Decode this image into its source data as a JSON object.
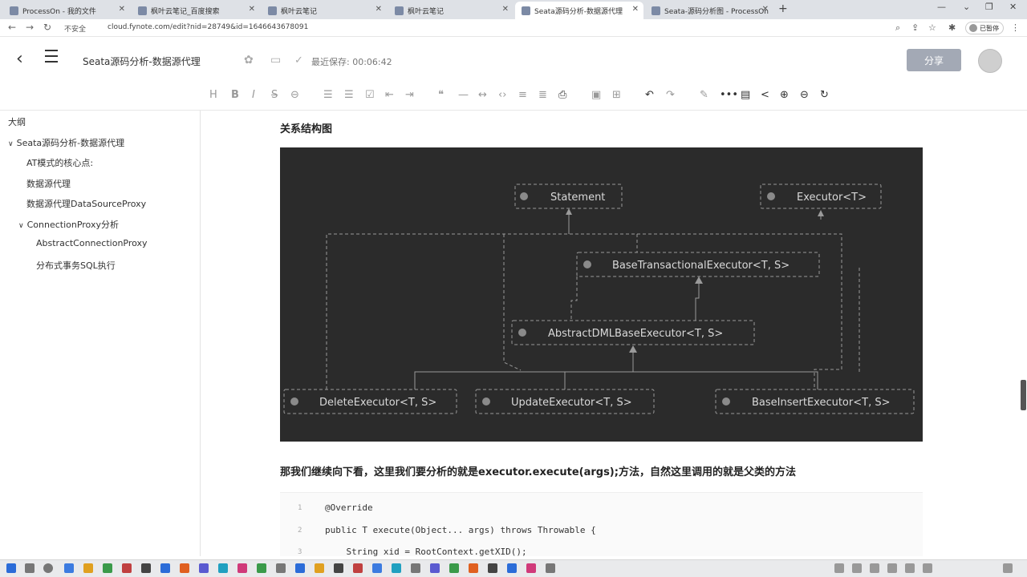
{
  "browser": {
    "tabs": [
      {
        "label": "ProcessOn - 我的文件"
      },
      {
        "label": "枫叶云笔记_百度搜索"
      },
      {
        "label": "枫叶云笔记"
      },
      {
        "label": "枫叶云笔记"
      },
      {
        "label": "Seata源码分析-数据源代理"
      },
      {
        "label": "Seata-源码分析图 - ProcessOn"
      }
    ],
    "new_tab": "+",
    "security": "不安全",
    "url": "cloud.fynote.com/edit?nid=28749&id=1646643678091",
    "paused_label": "已暂停"
  },
  "app": {
    "title": "Seata源码分析-数据源代理",
    "saved_status": "最近保存: 00:06:42",
    "share_label": "分享"
  },
  "toolbar": {
    "icons": [
      "heading-icon",
      "bold-icon",
      "italic-icon",
      "strikethrough-icon",
      "link-icon",
      "bullet-list-icon",
      "ordered-list-icon",
      "checklist-icon",
      "outdent-icon",
      "indent-icon",
      "quote-icon",
      "divider-icon",
      "code-inline-icon",
      "code-block-icon",
      "align-icon",
      "format-icon",
      "print-icon",
      "image-icon",
      "table-icon",
      "undo-icon",
      "redo-icon",
      "pen-icon",
      "more-icon",
      "note-icon",
      "share-node-icon",
      "zoom-in-icon",
      "zoom-out-icon",
      "refresh-icon"
    ]
  },
  "outline": {
    "title": "大纲",
    "items": [
      {
        "label": "Seata源码分析-数据源代理"
      },
      {
        "label": "AT模式的核心点:"
      },
      {
        "label": "数据源代理"
      },
      {
        "label": "数据源代理DataSourceProxy"
      },
      {
        "label": "ConnectionProxy分析"
      },
      {
        "label": "AbstractConnectionProxy"
      },
      {
        "label": "分布式事务SQL执行"
      }
    ]
  },
  "content": {
    "heading": "关系结构图",
    "diagram": {
      "nodes": {
        "statement": "Statement",
        "executor": "Executor<T>",
        "base_tx": "BaseTransactionalExecutor<T, S>",
        "abstract_dml": "AbstractDMLBaseExecutor<T, S>",
        "delete": "DeleteExecutor<T, S>",
        "update": "UpdateExecutor<T, S>",
        "insert": "BaseInsertExecutor<T, S>"
      }
    },
    "paragraph": "那我们继续向下看，这里我们要分析的就是executor.execute(args);方法，自然这里调用的就是父类的方法",
    "code": {
      "line_numbers": [
        "1",
        "2",
        "3"
      ],
      "lines": [
        "@Override",
        "public T execute(Object... args) throws Throwable {",
        "    String xid = RootContext.getXID();"
      ]
    }
  }
}
